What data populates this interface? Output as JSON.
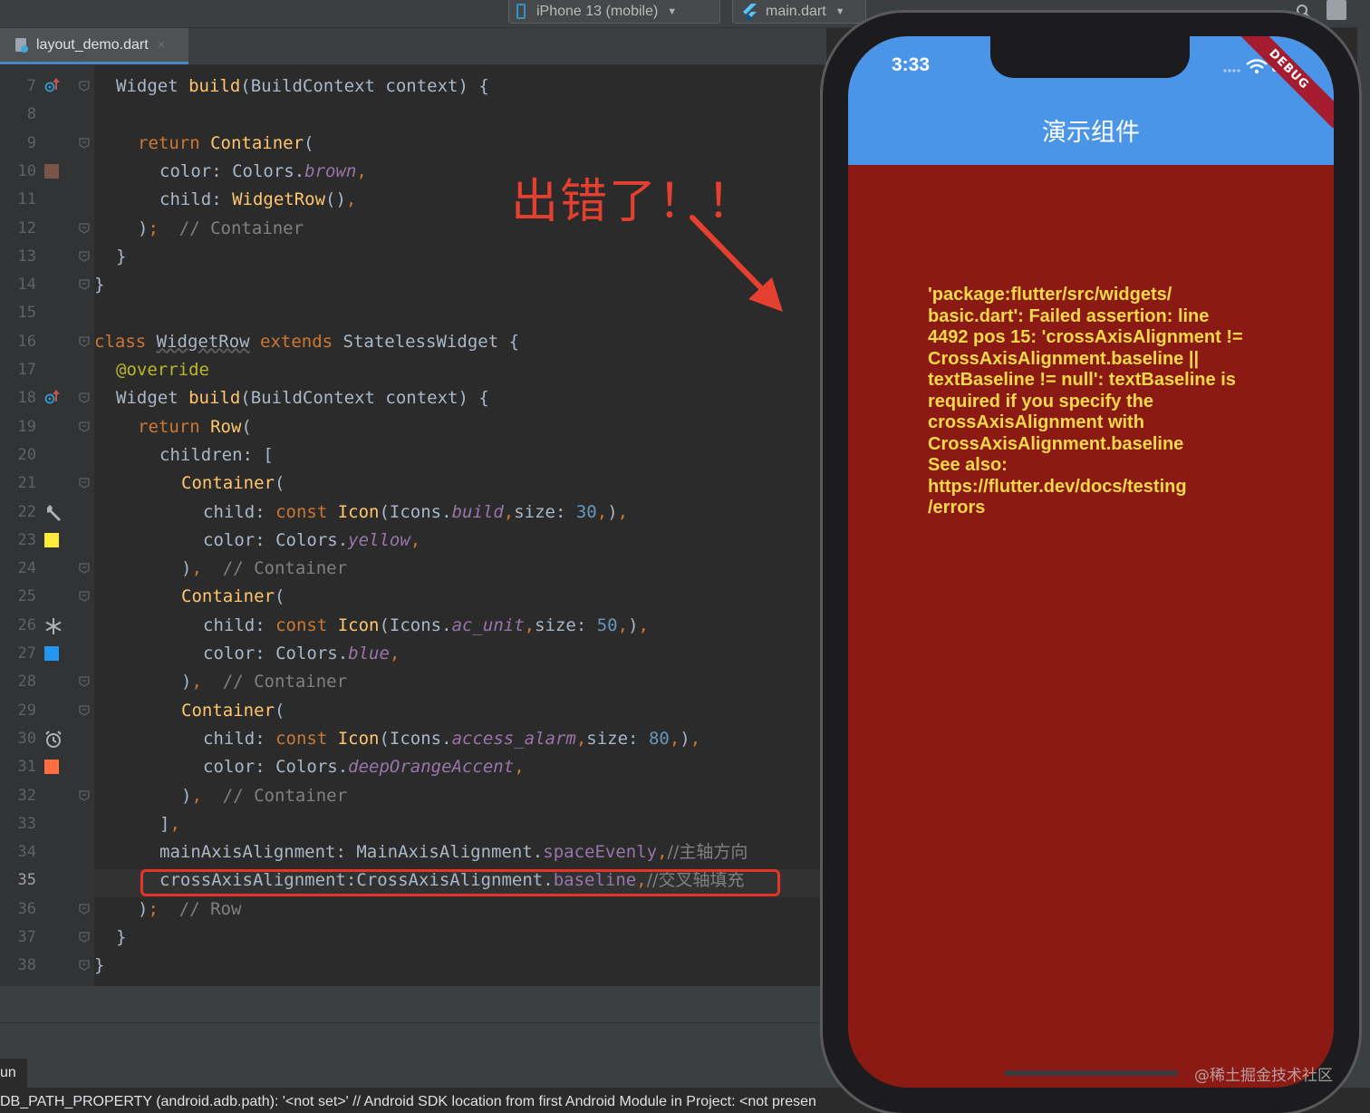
{
  "toolbar": {
    "device_selector": "iPhone 13 (mobile)",
    "run_config": "main.dart"
  },
  "tabs": [
    {
      "label": "layout_demo.dart",
      "close": "×"
    }
  ],
  "gutter": {
    "line_numbers": [
      "7",
      "8",
      "9",
      "10",
      "11",
      "12",
      "13",
      "14",
      "15",
      "16",
      "17",
      "18",
      "19",
      "20",
      "21",
      "22",
      "23",
      "24",
      "25",
      "26",
      "27",
      "28",
      "29",
      "30",
      "31",
      "32",
      "33",
      "34",
      "35",
      "36",
      "37",
      "38"
    ],
    "current_line": "35",
    "gutter_swatches": {
      "brown": "#795548",
      "yellow": "#ffeb3b",
      "blue": "#2196f3",
      "deep_orange_accent": "#ff6e40"
    }
  },
  "code": {
    "lines": [
      [
        {
          "c": "d",
          "t": "Widget "
        },
        {
          "c": "t",
          "t": "build"
        },
        {
          "c": "d",
          "t": "(BuildContext context) {"
        }
      ],
      [],
      [
        {
          "c": "k",
          "t": "return "
        },
        {
          "c": "t",
          "t": "Container"
        },
        {
          "c": "d",
          "t": "("
        }
      ],
      [
        {
          "c": "d",
          "t": "color: Colors."
        },
        {
          "c": "f",
          "t": "brown"
        },
        {
          "c": "k",
          "t": ","
        }
      ],
      [
        {
          "c": "d",
          "t": "child: "
        },
        {
          "c": "t",
          "t": "WidgetRow"
        },
        {
          "c": "d",
          "t": "()"
        },
        {
          "c": "k",
          "t": ","
        }
      ],
      [
        {
          "c": "d",
          "t": ")"
        },
        {
          "c": "k",
          "t": ";"
        },
        {
          "c": "c",
          "t": "  // Container"
        }
      ],
      [
        {
          "c": "d",
          "t": "}"
        }
      ],
      [
        {
          "c": "d",
          "t": "}"
        }
      ],
      [],
      [
        {
          "c": "k",
          "t": "class "
        },
        {
          "c": "u",
          "t": "WidgetRow"
        },
        {
          "c": "k",
          "t": " extends "
        },
        {
          "c": "d",
          "t": "StatelessWidget {"
        }
      ],
      [
        {
          "c": "a",
          "t": "@override"
        }
      ],
      [
        {
          "c": "d",
          "t": "Widget "
        },
        {
          "c": "t",
          "t": "build"
        },
        {
          "c": "d",
          "t": "(BuildContext context) {"
        }
      ],
      [
        {
          "c": "k",
          "t": "return "
        },
        {
          "c": "t",
          "t": "Row"
        },
        {
          "c": "d",
          "t": "("
        }
      ],
      [
        {
          "c": "d",
          "t": "children: ["
        }
      ],
      [
        {
          "c": "t",
          "t": "Container"
        },
        {
          "c": "d",
          "t": "("
        }
      ],
      [
        {
          "c": "d",
          "t": "child: "
        },
        {
          "c": "k",
          "t": "const "
        },
        {
          "c": "t",
          "t": "Icon"
        },
        {
          "c": "d",
          "t": "(Icons."
        },
        {
          "c": "f",
          "t": "build"
        },
        {
          "c": "k",
          "t": ","
        },
        {
          "c": "d",
          "t": "size: "
        },
        {
          "c": "n",
          "t": "30"
        },
        {
          "c": "k",
          "t": ","
        },
        {
          "c": "d",
          "t": ")"
        },
        {
          "c": "k",
          "t": ","
        }
      ],
      [
        {
          "c": "d",
          "t": "color: Colors."
        },
        {
          "c": "f",
          "t": "yellow"
        },
        {
          "c": "k",
          "t": ","
        }
      ],
      [
        {
          "c": "d",
          "t": ")"
        },
        {
          "c": "k",
          "t": ","
        },
        {
          "c": "c",
          "t": "  // Container"
        }
      ],
      [
        {
          "c": "t",
          "t": "Container"
        },
        {
          "c": "d",
          "t": "("
        }
      ],
      [
        {
          "c": "d",
          "t": "child: "
        },
        {
          "c": "k",
          "t": "const "
        },
        {
          "c": "t",
          "t": "Icon"
        },
        {
          "c": "d",
          "t": "(Icons."
        },
        {
          "c": "f",
          "t": "ac_unit"
        },
        {
          "c": "k",
          "t": ","
        },
        {
          "c": "d",
          "t": "size: "
        },
        {
          "c": "n",
          "t": "50"
        },
        {
          "c": "k",
          "t": ","
        },
        {
          "c": "d",
          "t": ")"
        },
        {
          "c": "k",
          "t": ","
        }
      ],
      [
        {
          "c": "d",
          "t": "color: Colors."
        },
        {
          "c": "f",
          "t": "blue"
        },
        {
          "c": "k",
          "t": ","
        }
      ],
      [
        {
          "c": "d",
          "t": ")"
        },
        {
          "c": "k",
          "t": ","
        },
        {
          "c": "c",
          "t": "  // Container"
        }
      ],
      [
        {
          "c": "t",
          "t": "Container"
        },
        {
          "c": "d",
          "t": "("
        }
      ],
      [
        {
          "c": "d",
          "t": "child: "
        },
        {
          "c": "k",
          "t": "const "
        },
        {
          "c": "t",
          "t": "Icon"
        },
        {
          "c": "d",
          "t": "(Icons."
        },
        {
          "c": "f",
          "t": "access_alarm"
        },
        {
          "c": "k",
          "t": ","
        },
        {
          "c": "d",
          "t": "size: "
        },
        {
          "c": "n",
          "t": "80"
        },
        {
          "c": "k",
          "t": ","
        },
        {
          "c": "d",
          "t": ")"
        },
        {
          "c": "k",
          "t": ","
        }
      ],
      [
        {
          "c": "d",
          "t": "color: Colors."
        },
        {
          "c": "f",
          "t": "deepOrangeAccent"
        },
        {
          "c": "k",
          "t": ","
        }
      ],
      [
        {
          "c": "d",
          "t": ")"
        },
        {
          "c": "k",
          "t": ","
        },
        {
          "c": "c",
          "t": "  // Container"
        }
      ],
      [
        {
          "c": "d",
          "t": "]"
        },
        {
          "c": "k",
          "t": ","
        }
      ],
      [
        {
          "c": "d",
          "t": "mainAxisAlignment: MainAxisAlignment."
        },
        {
          "c": "fi",
          "t": "spaceEvenly"
        },
        {
          "c": "k",
          "t": ","
        },
        {
          "c": "cm",
          "t": "//主轴方向"
        }
      ],
      [
        {
          "c": "d",
          "t": "crossAxisAlignment:CrossAxisAlignment."
        },
        {
          "c": "fi",
          "t": "baseline"
        },
        {
          "c": "k",
          "t": ","
        },
        {
          "c": "cm",
          "t": "//交叉轴填充"
        }
      ],
      [
        {
          "c": "d",
          "t": ")"
        },
        {
          "c": "k",
          "t": ";"
        },
        {
          "c": "c",
          "t": "  // Row"
        }
      ],
      [
        {
          "c": "d",
          "t": "}"
        }
      ],
      [
        {
          "c": "d",
          "t": "}"
        }
      ]
    ]
  },
  "annotation": {
    "text": "出错了！！"
  },
  "console": {
    "run_tab_label": "un",
    "message": "DB_PATH_PROPERTY (android.adb.path): '<not set>' // Android SDK location from first Android Module in Project: <not presen"
  },
  "phone": {
    "status_time": "3:33",
    "app_title": "演示组件",
    "debug_banner": "DEBUG",
    "appbar_color": "#4a95e8",
    "body_color": "#8b1a14",
    "error_lines": [
      "'package:flutter/src/widgets/",
      "basic.dart': Failed assertion: line",
      "4492 pos 15: 'crossAxisAlignment !=",
      "CrossAxisAlignment.baseline ||",
      "textBaseline != null': textBaseline is",
      "required if you specify the",
      "crossAxisAlignment with",
      "CrossAxisAlignment.baseline",
      "See also:",
      "https://flutter.dev/docs/testing",
      "/errors"
    ]
  },
  "watermark": "@稀土掘金技术社区"
}
